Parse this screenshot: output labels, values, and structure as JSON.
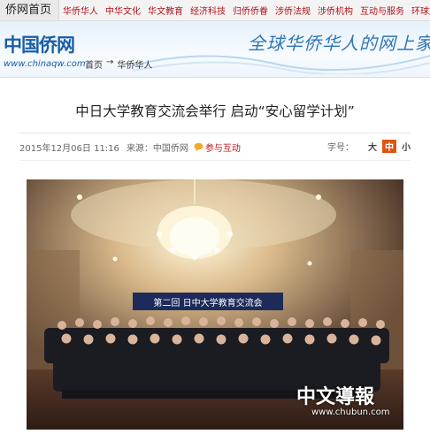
{
  "topnav": {
    "home": "侨网首页",
    "links": [
      "华侨华人",
      "中华文化",
      "华文教育",
      "经济科技",
      "归侨侨眷",
      "涉侨法规",
      "涉侨机构",
      "互动与服务",
      "环球旅"
    ]
  },
  "header": {
    "logo_text": "中国侨网",
    "logo_url": "www.chinaqw.com",
    "breadcrumb": [
      "首页",
      "→",
      "华侨华人"
    ],
    "slogan": "全球华侨华人的网上家园"
  },
  "article": {
    "title": "中日大学教育交流会举行 启动“安心留学计划”",
    "date": "2015年12月06日 11:16",
    "source": "来源：中国侨网",
    "interact": "参与互动",
    "font_size_label": "字号：",
    "font_sizes": [
      "大",
      "中",
      "小"
    ]
  },
  "photo": {
    "banner": "第二回  日中大学教育交流会",
    "watermark": "中文導報",
    "watermark_url": "www.chubun.com"
  },
  "colors": {
    "accent_red": "#c3171f",
    "brand_blue": "#1a5ea8",
    "active_orange": "#e2530f"
  }
}
